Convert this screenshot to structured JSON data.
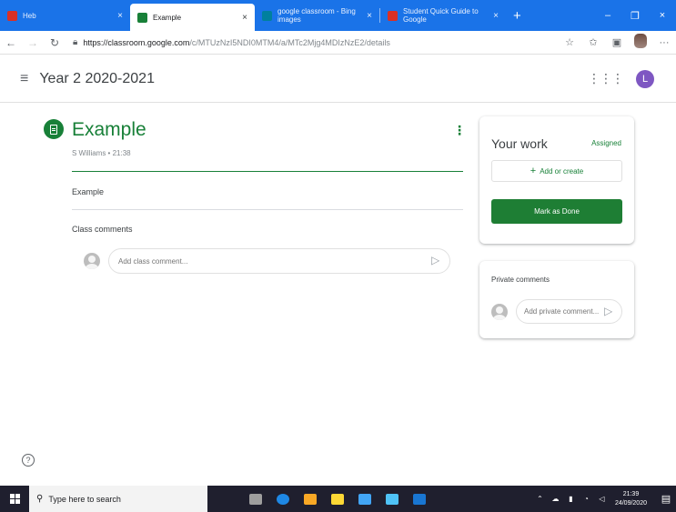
{
  "browser": {
    "tabs": [
      {
        "title": "Heb",
        "favicon_color": "#d93025",
        "active": false
      },
      {
        "title": "Example",
        "favicon_color": "#188038",
        "active": true
      },
      {
        "title": "google classroom - Bing images",
        "favicon_color": "#00809d",
        "active": false
      },
      {
        "title": "Student Quick Guide to Google",
        "favicon_color": "#d93025",
        "active": false
      }
    ],
    "close_glyph": "×",
    "new_tab_glyph": "+",
    "window_controls": [
      "–",
      "❐",
      "×"
    ],
    "url_host": "https://classroom.google.com",
    "url_path": "/c/MTUzNzI5NDI0MTM4/a/MTc2Mjg4MDIzNzE2/details",
    "icons": [
      "back-icon",
      "forward-icon",
      "refresh-icon",
      "lock-icon",
      "star-icon",
      "favorites-icon",
      "collections-icon",
      "profile-icon",
      "more-icon"
    ]
  },
  "header": {
    "class_name": "Year 2 2020-2021",
    "avatar_letter": "L",
    "avatar_color": "#7e57c2"
  },
  "assignment": {
    "title": "Example",
    "meta": "S Williams • 21:38",
    "description": "Example",
    "class_comments_label": "Class comments",
    "class_comment_placeholder": "Add class comment...",
    "accent_color": "#188038"
  },
  "your_work": {
    "title": "Your work",
    "status": "Assigned",
    "add_label": "Add or create",
    "mark_done_label": "Mark as Done"
  },
  "private_comments": {
    "label": "Private comments",
    "placeholder": "Add private comment..."
  },
  "taskbar": {
    "search_placeholder": "Type here to search",
    "time": "21:39",
    "date": "24/09/2020",
    "app_icon_colors": [
      "#9e9e9e",
      "#1e88e5",
      "#f9a825",
      "#fdd835",
      "#42a5f5",
      "#4fc3f7",
      "#1976d2"
    ]
  }
}
